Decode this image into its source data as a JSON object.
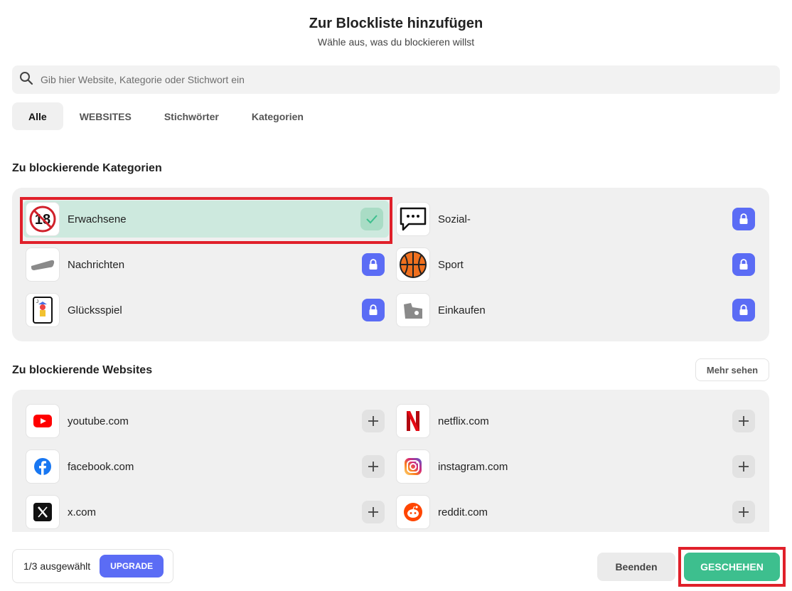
{
  "header": {
    "title": "Zur Blockliste hinzufügen",
    "subtitle": "Wähle aus, was du blockieren willst"
  },
  "search": {
    "placeholder": "Gib hier Website, Kategorie oder Stichwort ein",
    "value": ""
  },
  "tabs": [
    {
      "label": "Alle",
      "active": true
    },
    {
      "label": "WEBSITES",
      "active": false
    },
    {
      "label": "Stichwörter",
      "active": false
    },
    {
      "label": "Kategorien",
      "active": false
    }
  ],
  "categories": {
    "title": "Zu blockierende Kategorien",
    "items": [
      {
        "label": "Erwachsene",
        "icon": "adult-18-icon",
        "state": "selected"
      },
      {
        "label": "Sozial-",
        "icon": "chat-bubble-icon",
        "state": "locked"
      },
      {
        "label": "Nachrichten",
        "icon": "newspaper-icon",
        "state": "locked"
      },
      {
        "label": "Sport",
        "icon": "basketball-icon",
        "state": "locked"
      },
      {
        "label": "Glücksspiel",
        "icon": "playing-card-icon",
        "state": "locked"
      },
      {
        "label": "Einkaufen",
        "icon": "shopping-bag-icon",
        "state": "locked"
      }
    ]
  },
  "websites": {
    "title": "Zu blockierende Websites",
    "more_label": "Mehr sehen",
    "items": [
      {
        "label": "youtube.com",
        "icon": "youtube-icon"
      },
      {
        "label": "netflix.com",
        "icon": "netflix-icon"
      },
      {
        "label": "facebook.com",
        "icon": "facebook-icon"
      },
      {
        "label": "instagram.com",
        "icon": "instagram-icon"
      },
      {
        "label": "x.com",
        "icon": "x-icon"
      },
      {
        "label": "reddit.com",
        "icon": "reddit-icon"
      }
    ]
  },
  "footer": {
    "counter": "1/3 ausgewählt",
    "upgrade_label": "UPGRADE",
    "quit_label": "Beenden",
    "done_label": "GESCHEHEN"
  },
  "colors": {
    "accent": "#5b6cf5",
    "success": "#3dbf8e",
    "selected_bg": "#cde9de",
    "highlight": "#e0202a"
  }
}
